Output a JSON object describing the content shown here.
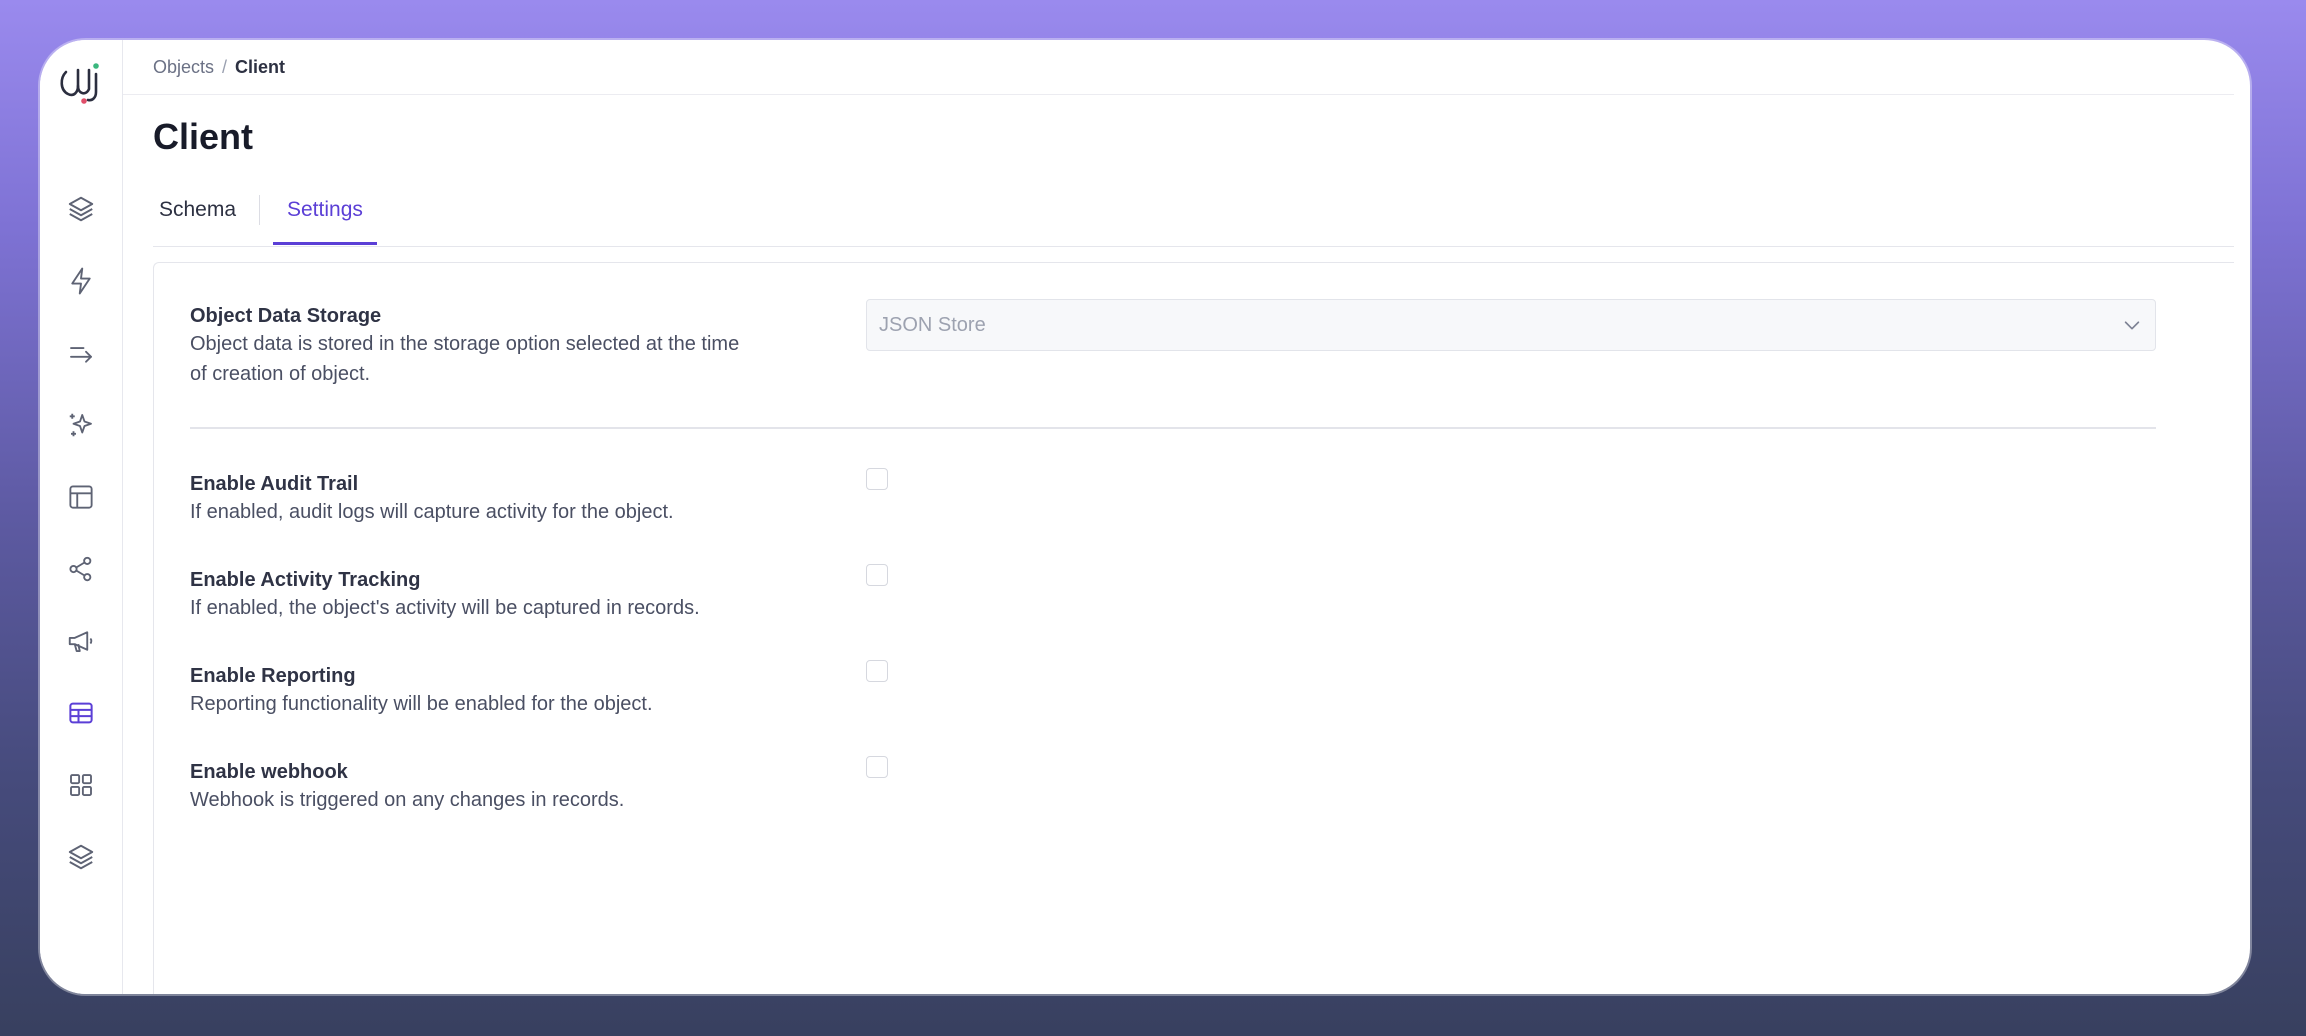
{
  "breadcrumb": {
    "parent": "Objects",
    "separator": "/",
    "current": "Client"
  },
  "page": {
    "title": "Client"
  },
  "tabs": [
    {
      "label": "Schema",
      "active": false
    },
    {
      "label": "Settings",
      "active": true
    }
  ],
  "storage": {
    "label": "Object Data Storage",
    "description_line1": "Object data is stored in the storage option selected at the time",
    "description_line2": "of creation of object.",
    "selected_value": "JSON Store"
  },
  "settings": [
    {
      "label": "Enable Audit Trail",
      "description": "If enabled, audit logs will capture activity for the object.",
      "checked": false
    },
    {
      "label": "Enable Activity Tracking",
      "description": "If enabled, the object's activity will be captured in records.",
      "checked": false
    },
    {
      "label": "Enable Reporting",
      "description": "Reporting functionality will be enabled for the object.",
      "checked": false
    },
    {
      "label": "Enable webhook",
      "description": "Webhook is triggered on any changes in records.",
      "checked": false
    }
  ],
  "sidebar": {
    "icons": [
      "layers-icon",
      "lightning-icon",
      "arrows-right-icon",
      "sparkles-icon",
      "layout-icon",
      "share-nodes-icon",
      "megaphone-icon",
      "table-icon",
      "grid-icon",
      "stack-icon"
    ],
    "active_icon": "table-icon"
  },
  "colors": {
    "accent": "#5b3fd6",
    "text_primary": "#181b29",
    "text_secondary": "#4a4f63",
    "border": "#e5e6ec"
  }
}
